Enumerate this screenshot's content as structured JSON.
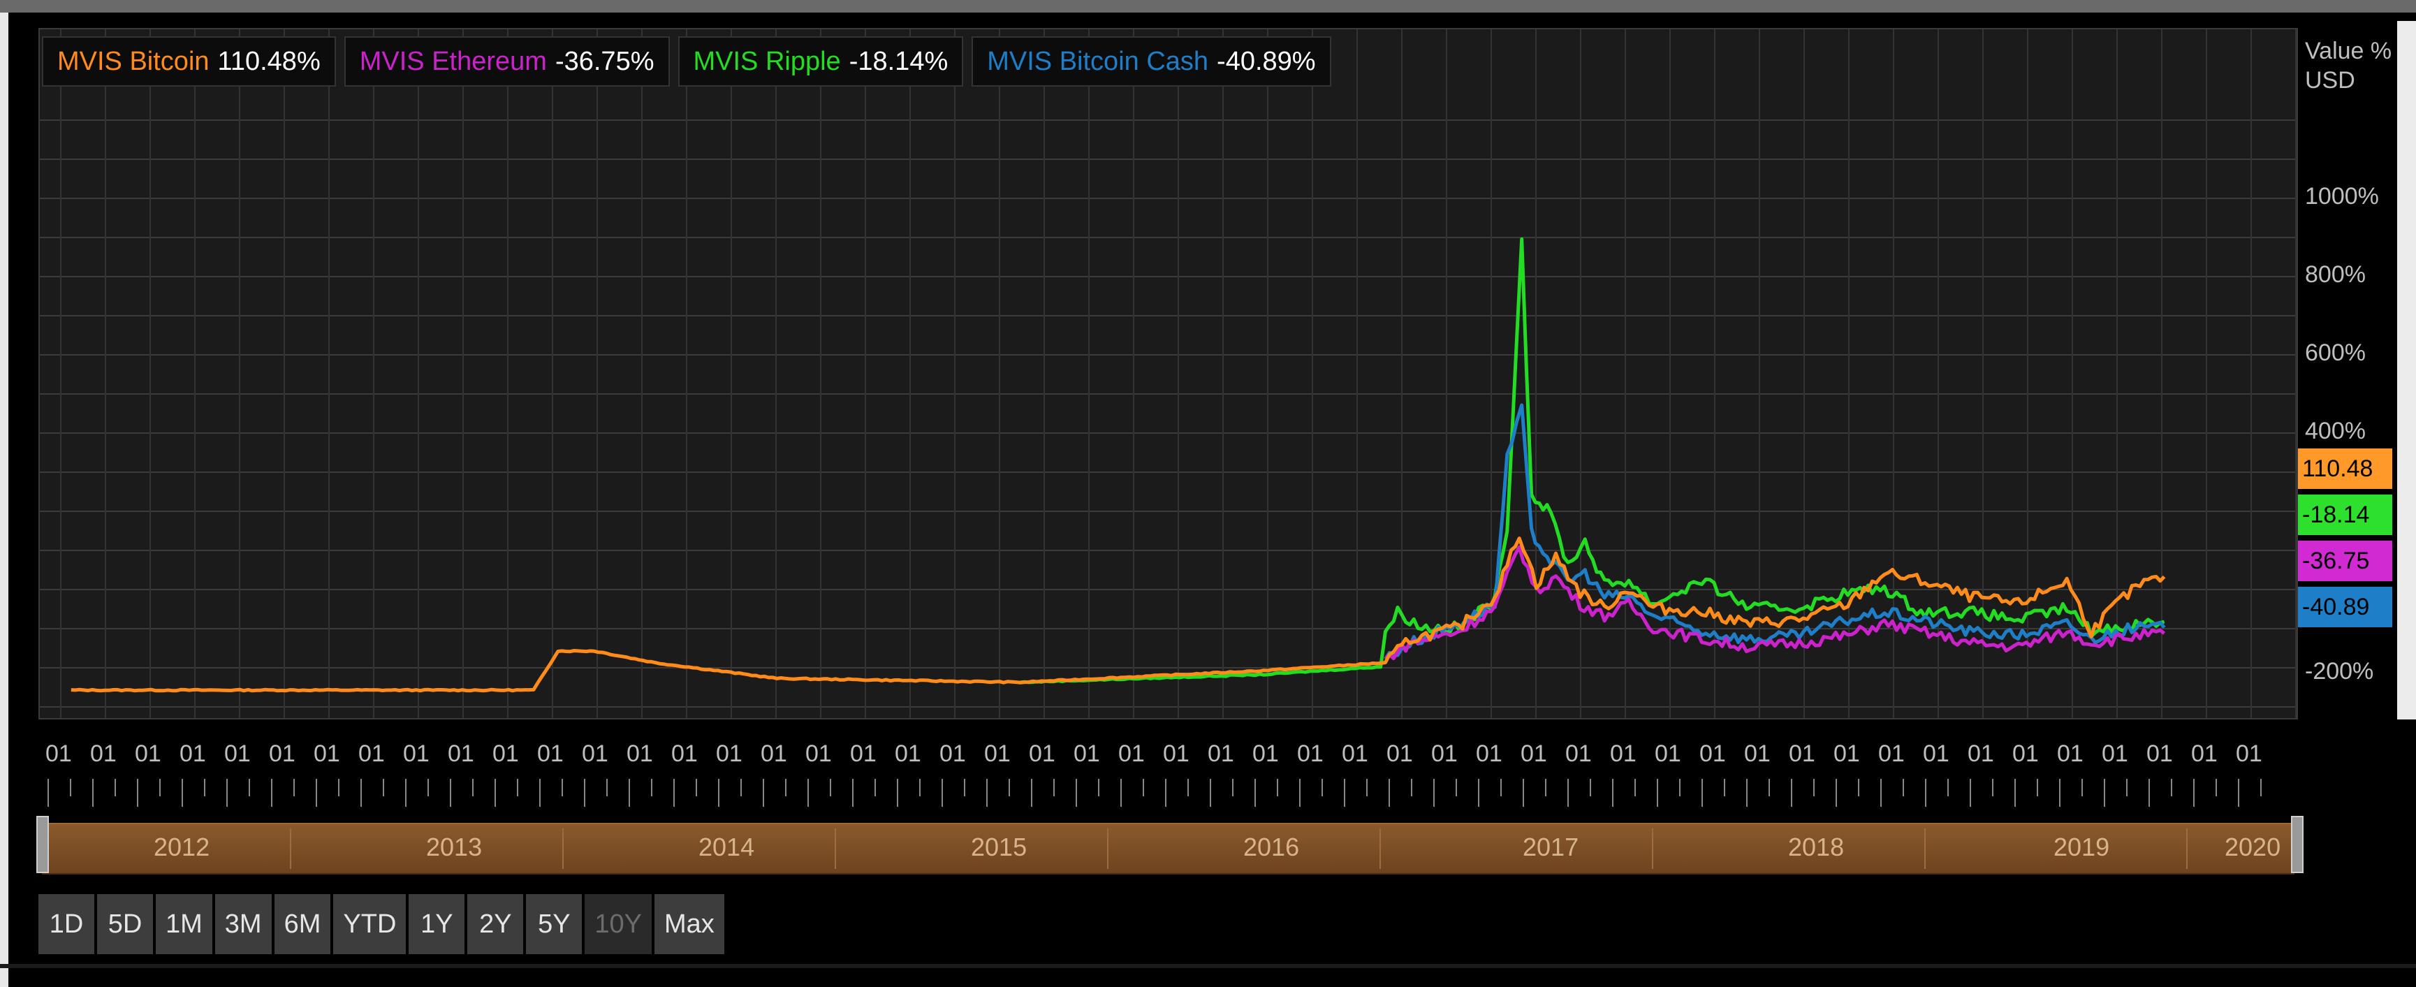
{
  "legend": [
    {
      "name": "MVIS Bitcoin",
      "value": "110.48%",
      "color": "#ff8c1a"
    },
    {
      "name": "MVIS Ethereum",
      "value": "-36.75%",
      "color": "#cc22cc"
    },
    {
      "name": "MVIS Ripple",
      "value": "-18.14%",
      "color": "#22dd22"
    },
    {
      "name": "MVIS Bitcoin Cash",
      "value": "-40.89%",
      "color": "#1e7fc8"
    }
  ],
  "axis_title": [
    "Value %",
    "USD"
  ],
  "last_values": [
    {
      "label": "110.48",
      "color": "#ff9a2a"
    },
    {
      "label": "-18.14",
      "color": "#2ee02e"
    },
    {
      "label": "-36.75",
      "color": "#d22ad2"
    },
    {
      "label": "-40.89",
      "color": "#1e7fc8"
    }
  ],
  "x_tick_label": "01",
  "navigator_years": [
    "2012",
    "2013",
    "2014",
    "2015",
    "2016",
    "2017",
    "2018",
    "2019",
    "2020"
  ],
  "range_buttons": [
    {
      "label": "1D",
      "enabled": true
    },
    {
      "label": "5D",
      "enabled": true
    },
    {
      "label": "1M",
      "enabled": true
    },
    {
      "label": "3M",
      "enabled": true
    },
    {
      "label": "6M",
      "enabled": true
    },
    {
      "label": "YTD",
      "enabled": true
    },
    {
      "label": "1Y",
      "enabled": true
    },
    {
      "label": "2Y",
      "enabled": true
    },
    {
      "label": "5Y",
      "enabled": true
    },
    {
      "label": "10Y",
      "enabled": false
    },
    {
      "label": "Max",
      "enabled": true
    }
  ],
  "chart_data": {
    "type": "line",
    "ylabel": "Value % USD",
    "y_ticks": [
      "1000%",
      "800%",
      "600%",
      "400%",
      "-200%"
    ],
    "x_years": [
      2011.5,
      2020.6
    ],
    "series": [
      {
        "name": "MVIS Bitcoin",
        "color": "#ff8c1a",
        "points": [
          [
            2011.6,
            -1
          ],
          [
            2012.5,
            -1
          ],
          [
            2013.5,
            -1
          ],
          [
            2013.6,
            0
          ],
          [
            2013.75,
            0
          ],
          [
            2014.0,
            -0.3
          ],
          [
            2014.5,
            -0.7
          ],
          [
            2015.5,
            -0.8
          ],
          [
            2016.5,
            -0.5
          ],
          [
            2017.0,
            -0.3
          ],
          [
            2017.1,
            0.3
          ],
          [
            2017.3,
            0.6
          ],
          [
            2017.45,
            1.4
          ],
          [
            2017.55,
            3.0
          ],
          [
            2017.62,
            1.7
          ],
          [
            2017.7,
            2.4
          ],
          [
            2017.8,
            1.5
          ],
          [
            2017.9,
            1.1
          ],
          [
            2018.0,
            1.6
          ],
          [
            2018.1,
            1.1
          ],
          [
            2018.3,
            1.0
          ],
          [
            2018.5,
            0.7
          ],
          [
            2018.7,
            0.8
          ],
          [
            2018.9,
            1.2
          ],
          [
            2019.05,
            2.0
          ],
          [
            2019.2,
            1.8
          ],
          [
            2019.4,
            1.4
          ],
          [
            2019.6,
            1.2
          ],
          [
            2019.8,
            1.8
          ],
          [
            2019.9,
            0.5
          ],
          [
            2020.0,
            1.2
          ],
          [
            2020.1,
            1.7
          ],
          [
            2020.2,
            1.9
          ]
        ]
      },
      {
        "name": "MVIS Ethereum",
        "color": "#cc22cc",
        "points": [
          [
            2017.0,
            -0.2
          ],
          [
            2017.1,
            0.2
          ],
          [
            2017.3,
            0.5
          ],
          [
            2017.45,
            1.1
          ],
          [
            2017.55,
            2.7
          ],
          [
            2017.62,
            1.5
          ],
          [
            2017.7,
            1.9
          ],
          [
            2017.8,
            1.2
          ],
          [
            2017.9,
            0.9
          ],
          [
            2018.0,
            1.2
          ],
          [
            2018.1,
            0.6
          ],
          [
            2018.3,
            0.3
          ],
          [
            2018.5,
            0.1
          ],
          [
            2018.7,
            0.2
          ],
          [
            2018.9,
            0.4
          ],
          [
            2019.05,
            0.7
          ],
          [
            2019.2,
            0.5
          ],
          [
            2019.4,
            0.2
          ],
          [
            2019.6,
            0.1
          ],
          [
            2019.8,
            0.5
          ],
          [
            2019.9,
            0.2
          ],
          [
            2020.0,
            0.3
          ],
          [
            2020.1,
            0.4
          ],
          [
            2020.2,
            0.45
          ]
        ]
      },
      {
        "name": "MVIS Ripple",
        "color": "#22dd22",
        "points": [
          [
            2015.5,
            -0.8
          ],
          [
            2016.5,
            -0.6
          ],
          [
            2016.98,
            -0.4
          ],
          [
            2017.0,
            0.5
          ],
          [
            2017.05,
            1.0
          ],
          [
            2017.15,
            0.6
          ],
          [
            2017.3,
            0.6
          ],
          [
            2017.45,
            1.3
          ],
          [
            2017.5,
            3.2
          ],
          [
            2017.56,
            10.5
          ],
          [
            2017.6,
            4.0
          ],
          [
            2017.68,
            3.5
          ],
          [
            2017.75,
            2.2
          ],
          [
            2017.82,
            2.8
          ],
          [
            2017.9,
            1.7
          ],
          [
            2018.0,
            1.8
          ],
          [
            2018.1,
            1.2
          ],
          [
            2018.3,
            1.8
          ],
          [
            2018.5,
            1.1
          ],
          [
            2018.7,
            1.1
          ],
          [
            2018.9,
            1.5
          ],
          [
            2019.05,
            1.6
          ],
          [
            2019.2,
            1.0
          ],
          [
            2019.4,
            1.0
          ],
          [
            2019.6,
            0.8
          ],
          [
            2019.8,
            1.1
          ],
          [
            2019.9,
            0.5
          ],
          [
            2020.0,
            0.6
          ],
          [
            2020.1,
            0.7
          ],
          [
            2020.2,
            0.75
          ]
        ]
      },
      {
        "name": "MVIS Bitcoin Cash",
        "color": "#1e7fc8",
        "points": [
          [
            2017.0,
            -0.2
          ],
          [
            2017.1,
            0.2
          ],
          [
            2017.3,
            0.7
          ],
          [
            2017.45,
            1.2
          ],
          [
            2017.5,
            4.9
          ],
          [
            2017.56,
            6.2
          ],
          [
            2017.6,
            3.0
          ],
          [
            2017.68,
            2.3
          ],
          [
            2017.75,
            1.8
          ],
          [
            2017.82,
            2.0
          ],
          [
            2017.9,
            1.4
          ],
          [
            2018.0,
            1.4
          ],
          [
            2018.1,
            0.9
          ],
          [
            2018.3,
            0.5
          ],
          [
            2018.5,
            0.3
          ],
          [
            2018.7,
            0.4
          ],
          [
            2018.9,
            0.8
          ],
          [
            2019.05,
            1.0
          ],
          [
            2019.2,
            0.8
          ],
          [
            2019.4,
            0.5
          ],
          [
            2019.6,
            0.4
          ],
          [
            2019.8,
            0.7
          ],
          [
            2019.9,
            0.3
          ],
          [
            2020.0,
            0.5
          ],
          [
            2020.1,
            0.6
          ],
          [
            2020.2,
            0.6
          ]
        ]
      }
    ]
  }
}
